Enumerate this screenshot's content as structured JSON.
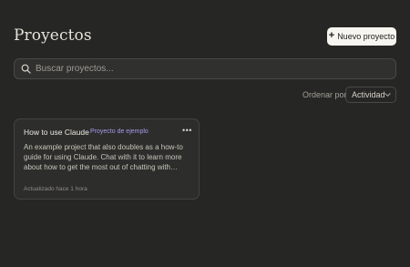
{
  "header": {
    "title": "Proyectos",
    "new_project_label": "Nuevo proyecto",
    "new_project_icon": "plus-icon"
  },
  "search": {
    "placeholder": "Buscar proyectos...",
    "value": "",
    "icon": "search-icon"
  },
  "sort": {
    "label": "Ordenar por",
    "selected": "Actividad",
    "icon": "chevron-down-icon"
  },
  "projects": [
    {
      "title": "How to use Claude",
      "badge": "Proyecto de ejemplo",
      "description": "An example project that also doubles as a how-to guide for using Claude. Chat with it to learn more about how to get the most out of chatting with…",
      "updated": "Actualizado hace 1 hora",
      "menu_icon": "more-horizontal-icon"
    }
  ],
  "colors": {
    "background": "#262624",
    "card": "#2d2d2b",
    "badge": "#a79af0",
    "button": "#f7f5ef"
  }
}
